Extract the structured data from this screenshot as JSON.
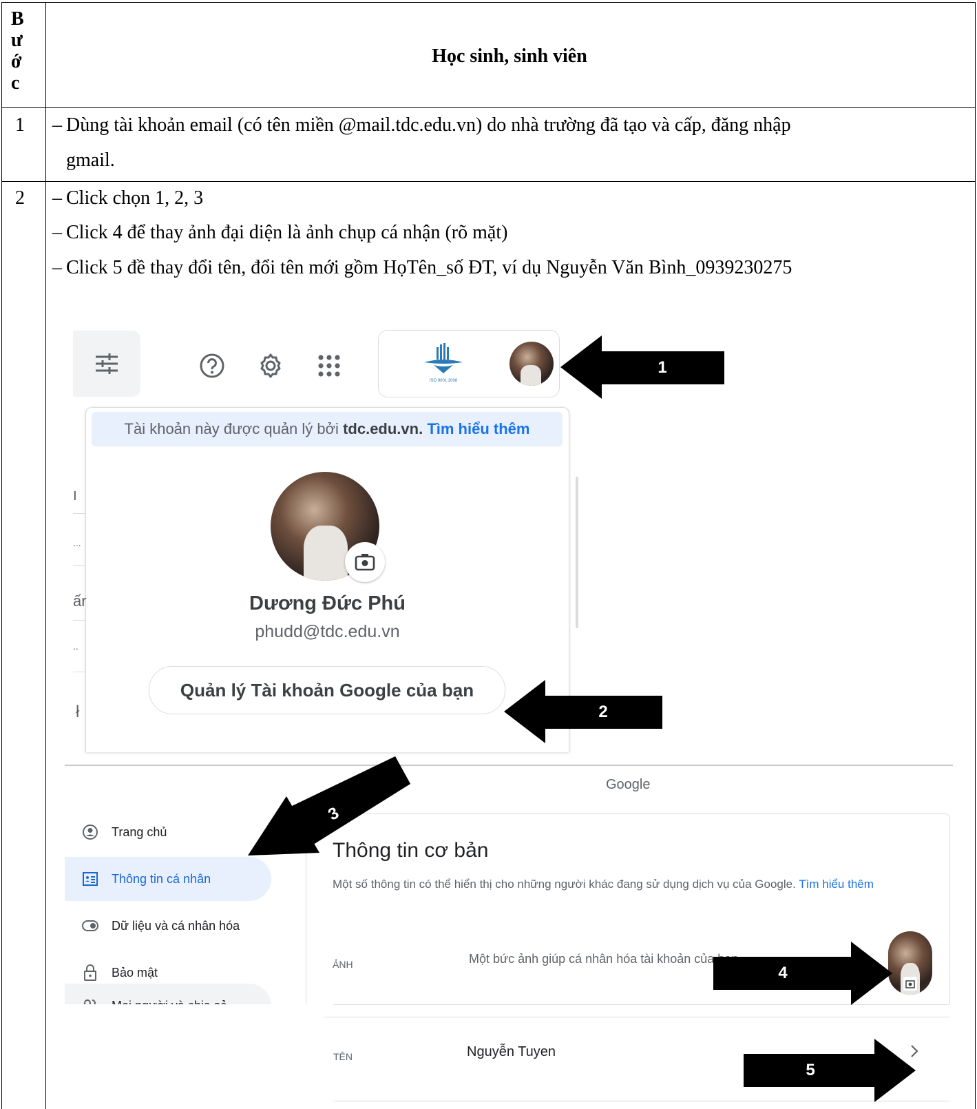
{
  "table": {
    "header_step": "Bước",
    "header_step_letters": [
      "B",
      "ư",
      "ớ",
      "c"
    ],
    "header_title": "Học sinh, sinh viên",
    "rows": [
      {
        "step": "1",
        "lines": [
          "Dùng tài khoản email (có tên miền @mail.tdc.edu.vn) do nhà trường đã tạo và cấp, đăng nhập",
          "gmail."
        ]
      },
      {
        "step": "2",
        "lines": [
          "Click chọn 1, 2, 3",
          "Click 4 để thay ảnh đại diện là ảnh chụp cá nhận (rõ mặt)",
          "Click 5 đề thay đổi tên, đổi tên mới gồm HọTên_số ĐT, ví dụ Nguyễn Văn Bình_0939230275"
        ]
      }
    ]
  },
  "account_popup": {
    "managed_notice": "Tài khoản này được quản lý bởi",
    "managed_domain": "tdc.edu.vn.",
    "learn_more": "Tìm hiểu thêm",
    "user_name": "Dương Đức Phú",
    "user_email": "phudd@tdc.edu.vn",
    "manage_button": "Quản lý Tài khoản Google của bạn",
    "logo_caption": "ISO 9001:2008",
    "side_fragments": [
      "ו",
      "...",
      "ấr",
      "..",
      "ł"
    ]
  },
  "callouts": [
    "1",
    "2",
    "3",
    "4",
    "5"
  ],
  "account_page": {
    "brand": "Google",
    "nav": [
      {
        "label": "Trang chủ",
        "icon": "account-circle-icon",
        "active": false
      },
      {
        "label": "Thông tin cá nhân",
        "icon": "id-card-icon",
        "active": true
      },
      {
        "label": "Dữ liệu và cá nhân hóa",
        "icon": "toggle-icon",
        "active": false
      },
      {
        "label": "Bảo mật",
        "icon": "lock-icon",
        "active": false
      },
      {
        "label": "Mọi người và chia sẻ",
        "icon": "people-icon",
        "active": false
      }
    ],
    "section_title": "Thông tin cơ bản",
    "section_desc": "Một số thông tin có thể hiển thị cho những người khác đang sử dụng dịch vụ của Google.",
    "section_learn_more": "Tìm hiểu thêm",
    "photo_label": "ẢNH",
    "photo_desc": "Một bức ảnh giúp cá nhân hóa tài khoản của bạn",
    "name_label": "TÊN",
    "name_value": "Nguyễn Tuyen"
  },
  "colors": {
    "link_blue": "#1a73e8",
    "notice_bg": "#e8f0fe",
    "active_nav_bg": "#e8f0fe",
    "text_dark": "#202124",
    "text_grey": "#5f6368"
  }
}
